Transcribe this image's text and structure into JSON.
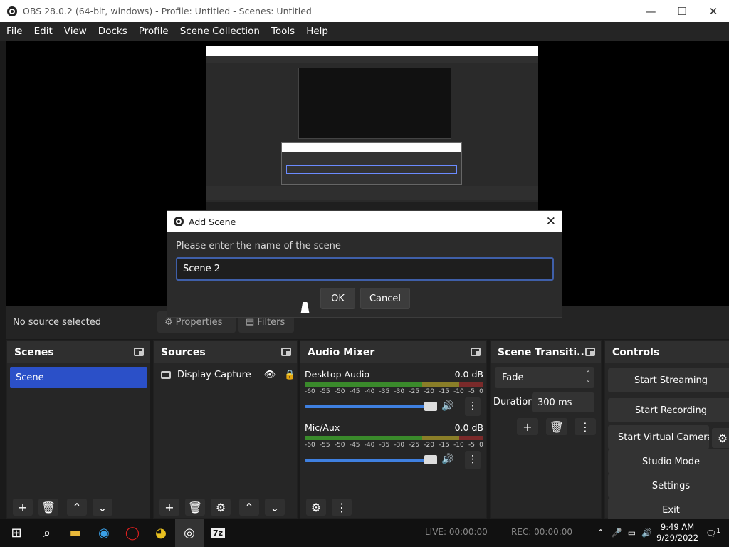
{
  "window": {
    "title": "OBS 28.0.2 (64-bit, windows) - Profile: Untitled - Scenes: Untitled",
    "minimize": "—",
    "maximize": "☐",
    "close": "✕"
  },
  "menu": [
    "File",
    "Edit",
    "View",
    "Docks",
    "Profile",
    "Scene Collection",
    "Tools",
    "Help"
  ],
  "dialog": {
    "title": "Add Scene",
    "prompt": "Please enter the name of the scene",
    "value": "Scene 2",
    "ok": "OK",
    "cancel": "Cancel",
    "close": "✕"
  },
  "status": {
    "no_source": "No source selected",
    "properties": "Properties",
    "filters": "Filters"
  },
  "scenes": {
    "title": "Scenes",
    "items": [
      "Scene"
    ]
  },
  "sources": {
    "title": "Sources",
    "items": [
      "Display Capture"
    ]
  },
  "mixer": {
    "title": "Audio Mixer",
    "channels": [
      {
        "name": "Desktop Audio",
        "db": "0.0 dB"
      },
      {
        "name": "Mic/Aux",
        "db": "0.0 dB"
      }
    ],
    "ticks": [
      "-60",
      "-55",
      "-50",
      "-45",
      "-40",
      "-35",
      "-30",
      "-25",
      "-20",
      "-15",
      "-10",
      "-5",
      "0"
    ]
  },
  "transitions": {
    "title": "Scene Transiti...",
    "selected": "Fade",
    "duration_label": "Duration",
    "duration_value": "300 ms"
  },
  "controls": {
    "title": "Controls",
    "buttons": [
      "Start Streaming",
      "Start Recording",
      "Start Virtual Camera",
      "Studio Mode",
      "Settings",
      "Exit"
    ]
  },
  "taskbar": {
    "live": "LIVE: 00:00:00",
    "rec": "REC: 00:00:00",
    "time": "9:49 AM",
    "date": "9/29/2022",
    "notifications": "1"
  }
}
